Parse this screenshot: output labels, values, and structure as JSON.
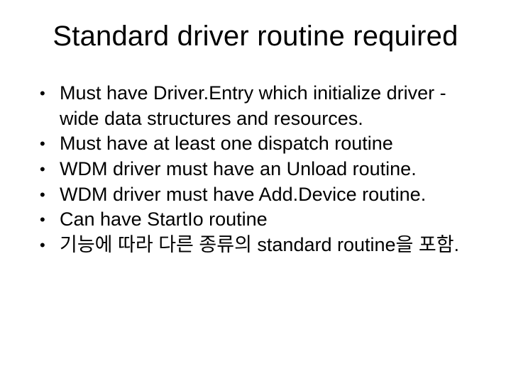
{
  "slide": {
    "title": "Standard driver routine required",
    "bullets": [
      "Must have Driver.Entry which initialize driver -wide data structures and resources.",
      "Must have at least one dispatch routine",
      "WDM driver must have an Unload routine.",
      "WDM driver must have Add.Device routine.",
      "Can have StartIo routine",
      "기능에 따라 다른 종류의 standard routine을 포함."
    ]
  }
}
